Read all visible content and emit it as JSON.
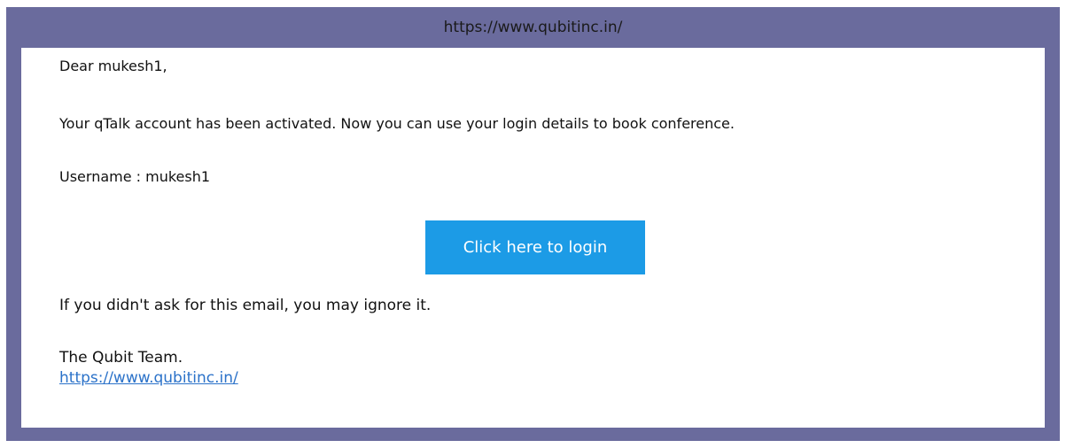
{
  "header": {
    "url": "https://www.qubitinc.in/"
  },
  "email": {
    "greeting": "Dear mukesh1,",
    "message": "Your qTalk account has been activated. Now you can use your login details to book conference.",
    "username_line": "Username : mukesh1",
    "login_button_label": "Click here to login",
    "ignore_notice": "If you didn't ask for this email, you may ignore it.",
    "signoff": "The Qubit Team.",
    "footer_link": "https://www.qubitinc.in/"
  },
  "colors": {
    "frame_background": "#6a6b9d",
    "button_background": "#1c9be6",
    "link": "#2b72c9"
  }
}
